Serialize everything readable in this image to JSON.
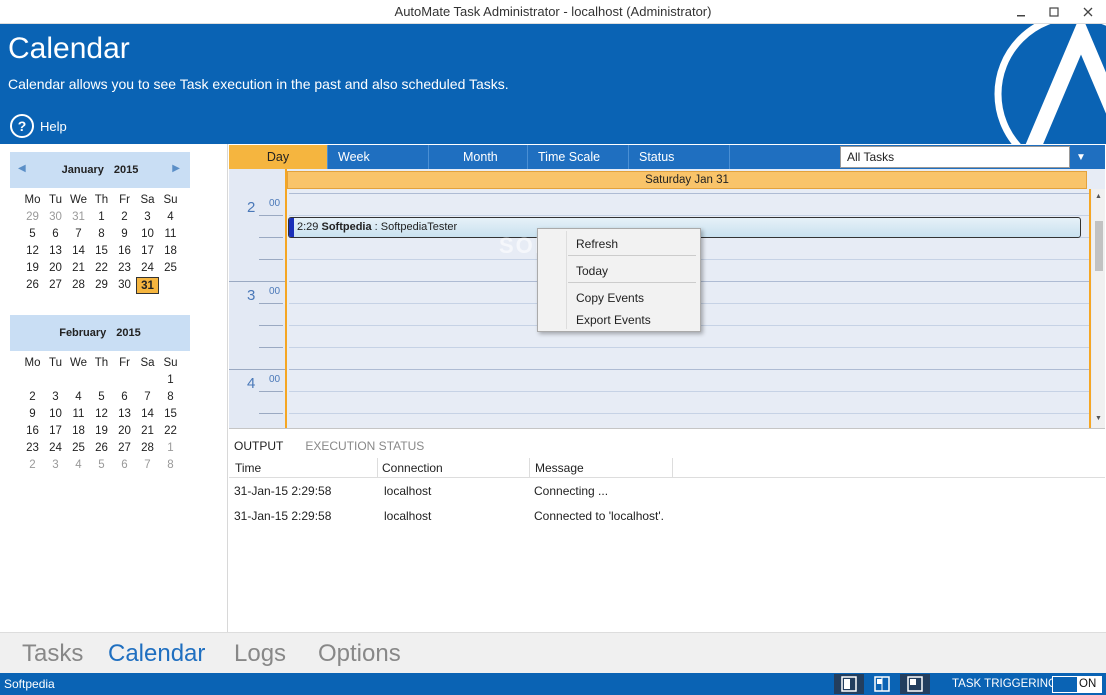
{
  "window": {
    "title": "AutoMate Task Administrator - localhost (Administrator)"
  },
  "header": {
    "title": "Calendar",
    "subtitle": "Calendar allows you to see Task execution in the past and also scheduled Tasks.",
    "help_label": "Help"
  },
  "calendars": [
    {
      "month": "January",
      "year": "2015",
      "weekdays": [
        "Mo",
        "Tu",
        "We",
        "Th",
        "Fr",
        "Sa",
        "Su"
      ],
      "days": [
        {
          "d": "29",
          "dim": true
        },
        {
          "d": "30",
          "dim": true
        },
        {
          "d": "31",
          "dim": true
        },
        {
          "d": "1"
        },
        {
          "d": "2"
        },
        {
          "d": "3"
        },
        {
          "d": "4"
        },
        {
          "d": "5"
        },
        {
          "d": "6"
        },
        {
          "d": "7"
        },
        {
          "d": "8"
        },
        {
          "d": "9"
        },
        {
          "d": "10"
        },
        {
          "d": "11"
        },
        {
          "d": "12"
        },
        {
          "d": "13"
        },
        {
          "d": "14"
        },
        {
          "d": "15"
        },
        {
          "d": "16"
        },
        {
          "d": "17"
        },
        {
          "d": "18"
        },
        {
          "d": "19"
        },
        {
          "d": "20"
        },
        {
          "d": "21"
        },
        {
          "d": "22"
        },
        {
          "d": "23"
        },
        {
          "d": "24"
        },
        {
          "d": "25"
        },
        {
          "d": "26"
        },
        {
          "d": "27"
        },
        {
          "d": "28"
        },
        {
          "d": "29"
        },
        {
          "d": "30"
        },
        {
          "d": "31",
          "selected": true
        }
      ]
    },
    {
      "month": "February",
      "year": "2015",
      "weekdays": [
        "Mo",
        "Tu",
        "We",
        "Th",
        "Fr",
        "Sa",
        "Su"
      ],
      "days": [
        {
          "d": ""
        },
        {
          "d": ""
        },
        {
          "d": ""
        },
        {
          "d": ""
        },
        {
          "d": ""
        },
        {
          "d": ""
        },
        {
          "d": "1"
        },
        {
          "d": "2"
        },
        {
          "d": "3"
        },
        {
          "d": "4"
        },
        {
          "d": "5"
        },
        {
          "d": "6"
        },
        {
          "d": "7"
        },
        {
          "d": "8"
        },
        {
          "d": "9"
        },
        {
          "d": "10"
        },
        {
          "d": "11"
        },
        {
          "d": "12"
        },
        {
          "d": "13"
        },
        {
          "d": "14"
        },
        {
          "d": "15"
        },
        {
          "d": "16"
        },
        {
          "d": "17"
        },
        {
          "d": "18"
        },
        {
          "d": "19"
        },
        {
          "d": "20"
        },
        {
          "d": "21"
        },
        {
          "d": "22"
        },
        {
          "d": "23"
        },
        {
          "d": "24"
        },
        {
          "d": "25"
        },
        {
          "d": "26"
        },
        {
          "d": "27"
        },
        {
          "d": "28"
        },
        {
          "d": "1",
          "dim": true
        },
        {
          "d": "2",
          "dim": true
        },
        {
          "d": "3",
          "dim": true
        },
        {
          "d": "4",
          "dim": true
        },
        {
          "d": "5",
          "dim": true
        },
        {
          "d": "6",
          "dim": true
        },
        {
          "d": "7",
          "dim": true
        },
        {
          "d": "8",
          "dim": true
        }
      ]
    }
  ],
  "view_tabs": {
    "day": "Day",
    "week": "Week",
    "month": "Month",
    "time_scale": "Time Scale",
    "status": "Status"
  },
  "task_filter": {
    "selected": "All Tasks"
  },
  "dayview": {
    "date_header": "Saturday Jan 31",
    "hours": [
      "2",
      "3",
      "4"
    ],
    "minutes": "00",
    "event": {
      "time": "2:29",
      "name": "Softpedia",
      "separator": " : ",
      "detail": "SoftpediaTester"
    },
    "watermark": "SOFTPEDIA"
  },
  "context_menu": {
    "items": [
      "Refresh",
      "Today",
      "Copy Events",
      "Export Events"
    ]
  },
  "output": {
    "tabs": [
      "OUTPUT",
      "EXECUTION STATUS"
    ],
    "columns": [
      "Time",
      "Connection",
      "Message"
    ],
    "rows": [
      {
        "time": "31-Jan-15 2:29:58",
        "connection": "localhost",
        "message": "Connecting ..."
      },
      {
        "time": "31-Jan-15 2:29:58",
        "connection": "localhost",
        "message": "Connected to 'localhost'."
      }
    ]
  },
  "bottom_nav": [
    "Tasks",
    "Calendar",
    "Logs",
    "Options"
  ],
  "statusbar": {
    "text": "Softpedia",
    "trigger_label": "TASK TRIGGERING",
    "toggle_state": "ON"
  }
}
